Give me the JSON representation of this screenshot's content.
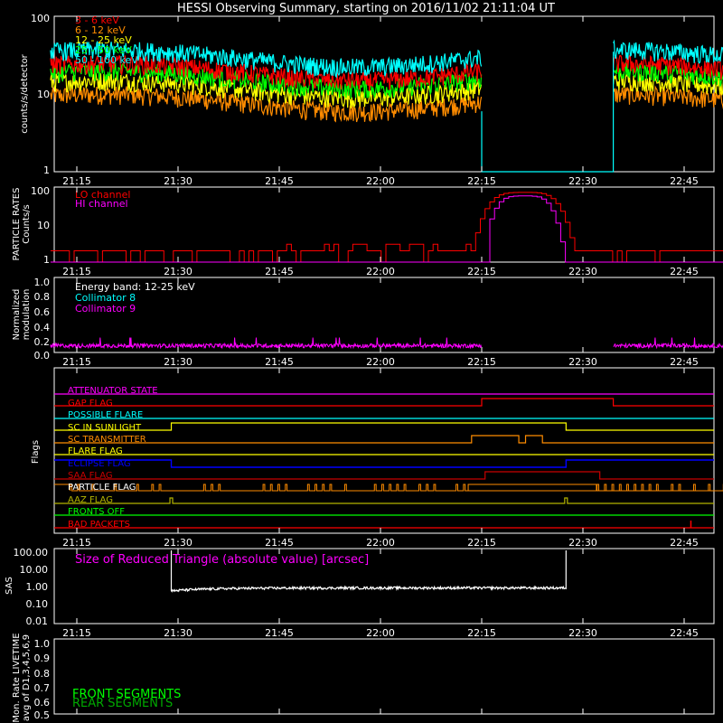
{
  "title": "HESSI Observing Summary, starting on 2016/11/02 21:11:04 UT",
  "time_ticks": [
    "21:15",
    "21:30",
    "21:45",
    "22:00",
    "22:15",
    "22:30",
    "22:45"
  ],
  "colors": {
    "red": "#ff0000",
    "orange": "#ff8c00",
    "yellow": "#ffff00",
    "green": "#00ff00",
    "cyan": "#00ffff",
    "magenta": "#ff00ff",
    "white": "#ffffff",
    "blue": "#0000ff",
    "darkred": "#c80000",
    "olive": "#b4b400",
    "darkgreen": "#00aa00"
  },
  "panels": {
    "rates": {
      "ylabel": "counts/s/detector",
      "yticks": [
        "100",
        "10",
        "1"
      ],
      "legend": [
        "3 - 6 keV",
        "6 - 12 keV",
        "12 - 25 keV",
        "25 - 50 keV",
        "50 - 100 keV"
      ]
    },
    "particle": {
      "ylabel1": "PARTICLE RATES",
      "ylabel2": "Counts/s",
      "yticks": [
        "100",
        "10",
        "1"
      ],
      "legend": [
        "LO channel",
        "HI channel"
      ]
    },
    "modulation": {
      "ylabel1": "Normalized",
      "ylabel2": "modulation",
      "yticks": [
        "1.0",
        "0.8",
        "0.6",
        "0.4",
        "0.2",
        "0.0"
      ],
      "legend": [
        "Energy band: 12-25 keV",
        "Collimator 8",
        "Collimator 9"
      ]
    },
    "flags": {
      "ylabel": "Flags",
      "labels": [
        "ATTENUATOR STATE",
        "GAP FLAG",
        "POSSIBLE FLARE",
        "SC IN SUNLIGHT",
        "SC TRANSMITTER",
        "FLARE FLAG",
        "ECLIPSE FLAG",
        "SAA FLAG",
        "PARTICLE FLAG",
        "AAZ FLAG",
        "FRONTS OFF",
        "BAD PACKETS"
      ]
    },
    "sas": {
      "ylabel": "SAS",
      "yticks": [
        "100.00",
        "10.00",
        "1.00",
        "0.10",
        "0.01"
      ],
      "annotation": "Size of Reduced Triangle (absolute value) [arcsec]"
    },
    "livetime": {
      "ylabel1": "Mon. Rate LIVETIME",
      "ylabel2": "avg of D1,3,4,5,6,9",
      "yticks": [
        "1.0",
        "0.9",
        "0.8",
        "0.7",
        "0.6",
        "0.5"
      ],
      "legend": [
        "FRONT SEGMENTS",
        "REAR SEGMENTS"
      ]
    }
  },
  "chart_data": [
    {
      "type": "line",
      "title": "HESSI Observing Summary, starting on 2016/11/02 21:11:04 UT",
      "ylabel": "counts/s/detector",
      "yscale": "log",
      "ylim": [
        1,
        100
      ],
      "xlim": [
        "21:11:04",
        "22:52"
      ],
      "gap": [
        "22:15",
        "22:34"
      ],
      "series": [
        {
          "name": "3 - 6 keV",
          "color": "#ff0000",
          "approx_level": 20
        },
        {
          "name": "6 - 12 keV",
          "color": "#ff8c00",
          "approx_level": 8
        },
        {
          "name": "12 - 25 keV",
          "color": "#ffff00",
          "approx_level": 12
        },
        {
          "name": "25 - 50 keV",
          "color": "#00ff00",
          "approx_level": 16
        },
        {
          "name": "50 - 100 keV",
          "color": "#00ffff",
          "approx_level": 30
        }
      ]
    },
    {
      "type": "line",
      "ylabel": "Counts/s",
      "yscale": "log",
      "ylim": [
        1,
        100
      ],
      "series": [
        {
          "name": "LO channel",
          "color": "#ff0000",
          "baseline": 2,
          "peak": 70,
          "peak_time": "22:21"
        },
        {
          "name": "HI channel",
          "color": "#ff00ff",
          "baseline": 1,
          "peak": 55,
          "peak_time": "22:21"
        }
      ]
    },
    {
      "type": "line",
      "ylabel": "modulation",
      "ylim": [
        0,
        1
      ],
      "series": [
        {
          "name": "Collimator 9",
          "color": "#ff00ff",
          "approx_level": 0.08
        }
      ]
    },
    {
      "type": "line",
      "ylabel": "SAS",
      "yscale": "log",
      "ylim": [
        0.01,
        100
      ],
      "series": [
        {
          "name": "Size of Reduced Triangle",
          "color": "#ffffff",
          "approx_level": 0.8,
          "range": [
            "21:29",
            "22:27"
          ]
        }
      ]
    }
  ]
}
